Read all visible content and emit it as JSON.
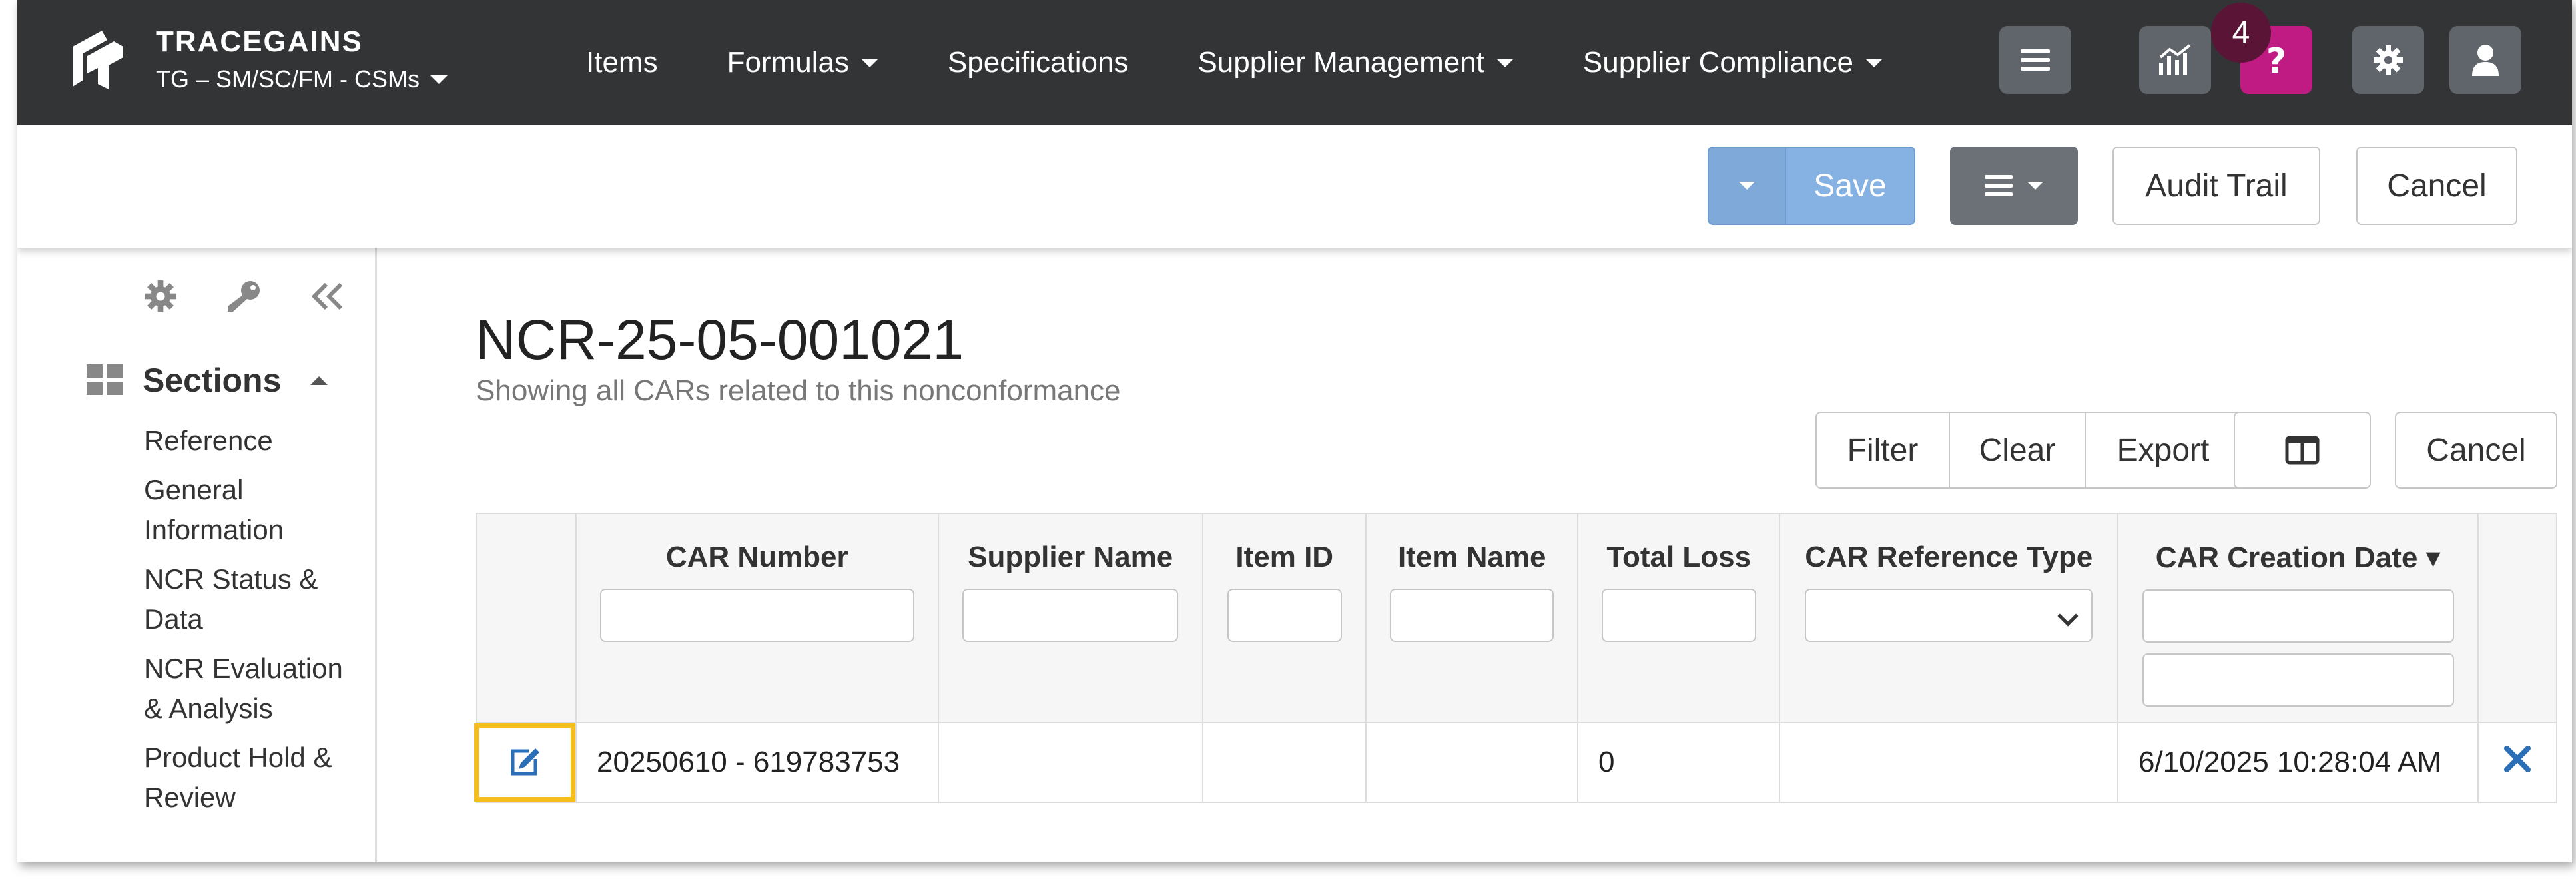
{
  "nav": {
    "brand": "TRACEGAINS",
    "org": "TG – SM/SC/FM - CSMs",
    "links": [
      "Items",
      "Formulas",
      "Specifications",
      "Supplier Management",
      "Supplier Compliance"
    ],
    "notification_count": "4",
    "colors": {
      "bar": "#333436",
      "help": "#c01a83",
      "badge": "#5a1436"
    },
    "icons": [
      "menu-icon",
      "analytics-icon",
      "help-icon",
      "gear-icon",
      "user-icon"
    ]
  },
  "toolbar": {
    "save_label": "Save",
    "audit_label": "Audit Trail",
    "cancel_label": "Cancel"
  },
  "sidebar": {
    "icons": [
      "gear-icon",
      "key-icon",
      "collapse-icon"
    ],
    "sections_label": "Sections",
    "items": [
      "Reference",
      "General Information",
      "NCR Status & Data",
      "NCR Evaluation & Analysis",
      "Product Hold & Review"
    ]
  },
  "main": {
    "title": "NCR-25-05-001021",
    "subtitle": "Showing all CARs related to this nonconformance",
    "filter_label": "Filter",
    "clear_label": "Clear",
    "export_label": "Export",
    "cancel_label": "Cancel"
  },
  "grid": {
    "columns": [
      "CAR Number",
      "Supplier Name",
      "Item ID",
      "Item Name",
      "Total Loss",
      "CAR Reference Type",
      "CAR Creation Date ▾"
    ],
    "rows": [
      {
        "car_number": "20250610 - 619783753",
        "supplier_name": "",
        "item_id": "",
        "item_name": "",
        "total_loss": "0",
        "car_reference_type": "",
        "car_creation_date": "6/10/2025 10:28:04 AM"
      }
    ]
  }
}
